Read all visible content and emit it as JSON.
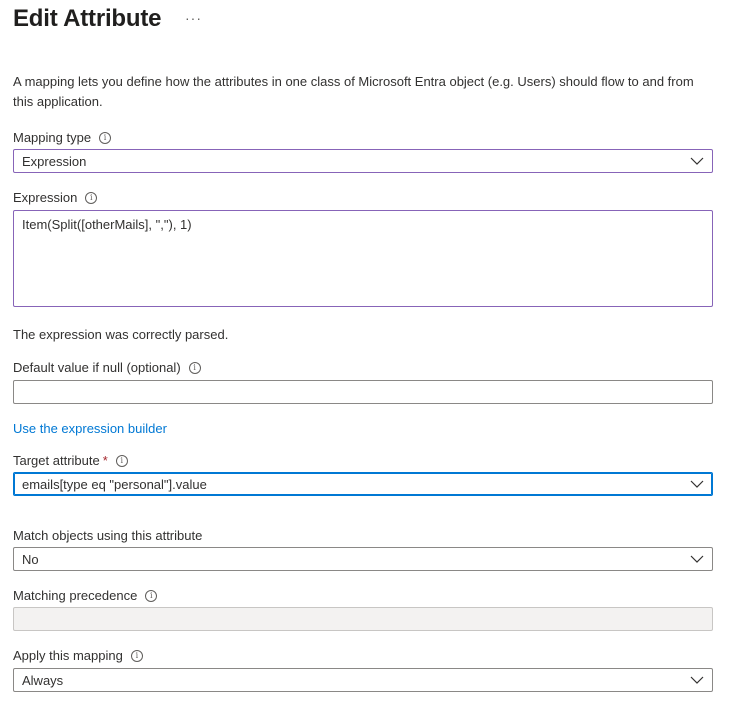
{
  "header": {
    "title": "Edit Attribute",
    "more": "···"
  },
  "description": "A mapping lets you define how the attributes in one class of Microsoft Entra object (e.g. Users) should flow to and from this application.",
  "mapping_type": {
    "label": "Mapping type",
    "value": "Expression"
  },
  "expression": {
    "label": "Expression",
    "value": "Item(Split([otherMails], \",\"), 1)",
    "status": "The expression was correctly parsed."
  },
  "default_value": {
    "label": "Default value if null (optional)",
    "value": ""
  },
  "expression_builder_link": "Use the expression builder",
  "target_attribute": {
    "label": "Target attribute",
    "required_mark": "*",
    "value": "emails[type eq \"personal\"].value"
  },
  "match_objects": {
    "label": "Match objects using this attribute",
    "value": "No"
  },
  "matching_precedence": {
    "label": "Matching precedence",
    "value": ""
  },
  "apply_mapping": {
    "label": "Apply this mapping",
    "value": "Always"
  },
  "colors": {
    "accent": "#0078d4",
    "focus": "#8764b8",
    "required": "#a4262c",
    "disabled": "#f3f2f1"
  }
}
